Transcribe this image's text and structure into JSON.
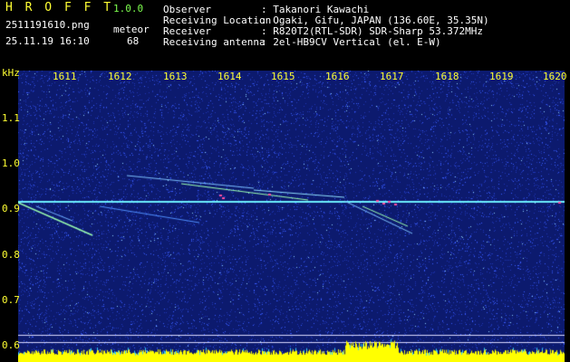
{
  "header": {
    "app_name": "H R O F F T",
    "version": "1.0.0",
    "filename": "2511191610.png",
    "meteor_label": "meteor",
    "timestamp": "25.11.19 16:10",
    "meteor_count": "68",
    "fields": [
      {
        "label": "Observer",
        "value": ": Takanori Kawachi"
      },
      {
        "label": "Receiving Location",
        "value": ": Ogaki, Gifu, JAPAN (136.60E, 35.35N)"
      },
      {
        "label": "Receiver",
        "value": ": R820T2(RTL-SDR) SDR-Sharp 53.372MHz"
      },
      {
        "label": "Receiving antenna",
        "value": ": 2el-HB9CV Vertical (el. E-W)"
      }
    ]
  },
  "plot": {
    "y_unit": "kHz",
    "y_ticks": [
      "1.1",
      "1.0",
      "0.9",
      "0.8",
      "0.7",
      "0.6"
    ],
    "x_ticks": [
      "1611",
      "1612",
      "1613",
      "1614",
      "1615",
      "1616",
      "1617",
      "1618",
      "1619",
      "1620"
    ],
    "colors": {
      "background": "#0c1a6e",
      "noise": "#3a5cff",
      "carrier": "#6cf0ff",
      "echo": "#9bffb0",
      "burst": "#ff4fa0",
      "bottom_bar": "#ffff00",
      "axis_text": "#ffff33"
    }
  }
}
